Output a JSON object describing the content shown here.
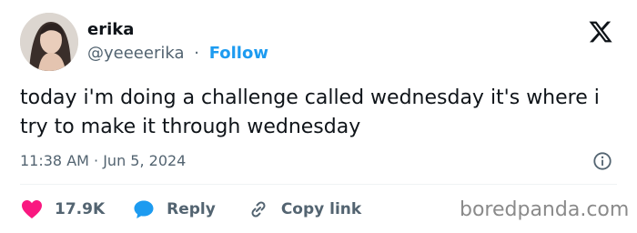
{
  "tweet": {
    "author": {
      "name": "erika",
      "handle": "@yeeeerika",
      "separator": "·",
      "follow_label": "Follow"
    },
    "text": "today i'm doing a challenge called wednesday it's where i try to make it through wednesday",
    "timestamp": "11:38 AM · Jun 5, 2024",
    "actions": {
      "like_count": "17.9K",
      "reply_label": "Reply",
      "copy_link_label": "Copy link"
    }
  },
  "icons": {
    "logo": "x-logo-icon",
    "info": "info-icon",
    "like": "heart-icon",
    "reply": "speech-bubble-icon",
    "copy": "link-icon"
  },
  "colors": {
    "accent": "#1d9bf0",
    "like": "#f91880",
    "text": "#0f1419",
    "muted": "#536471"
  },
  "watermark": "boredpanda.com"
}
